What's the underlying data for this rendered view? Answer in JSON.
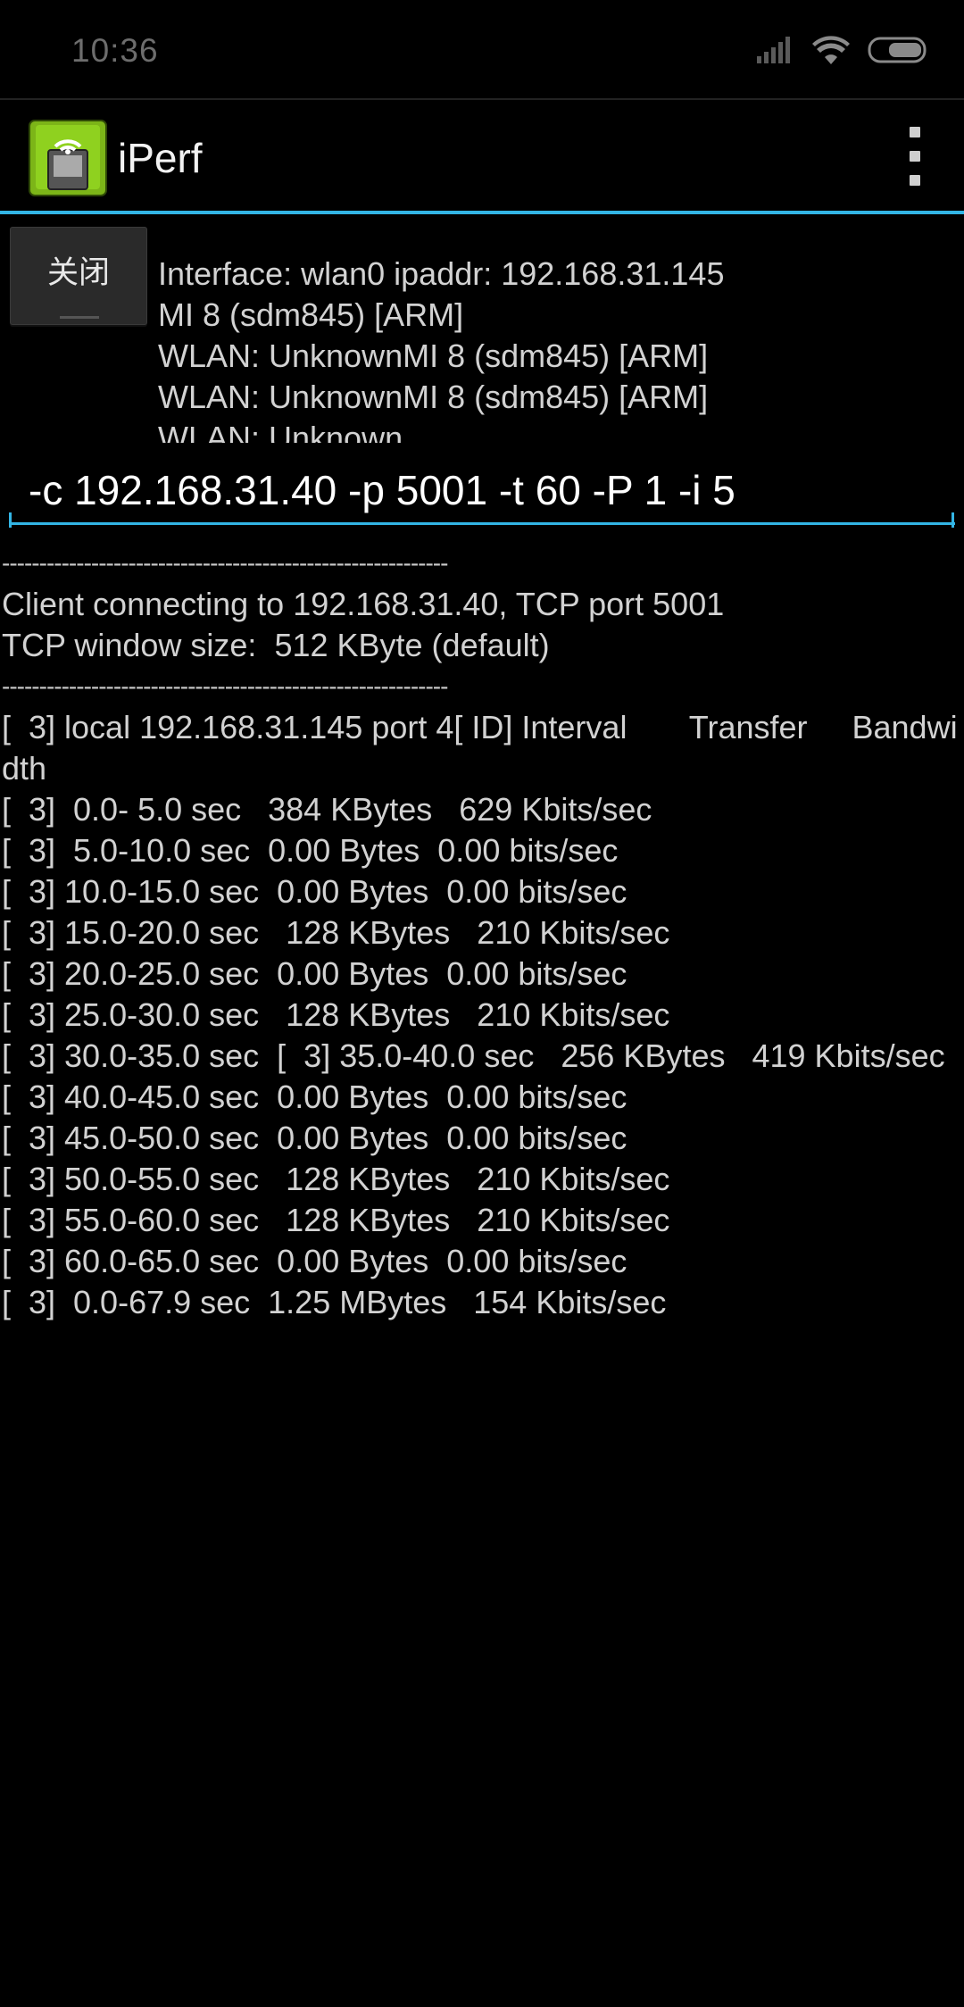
{
  "status_bar": {
    "time": "10:36",
    "icons": [
      "signal-icon",
      "wifi-icon",
      "battery-icon"
    ]
  },
  "action_bar": {
    "title": "iPerf",
    "icon": "app-icon",
    "menu_icon": "overflow-menu-icon"
  },
  "colors": {
    "accent": "#33b5e5",
    "background": "#000000",
    "text": "#d2d2d2"
  },
  "close_button": {
    "label": "关闭"
  },
  "info": {
    "lines": [
      "Interface: wlan0 ipaddr: 192.168.31.145",
      "MI 8 (sdm845) [ARM]",
      "WLAN: UnknownMI 8 (sdm845) [ARM]",
      "WLAN: UnknownMI 8 (sdm845) [ARM]",
      "WLAN: Unknown"
    ]
  },
  "command": {
    "value": "-c 192.168.31.40 -p 5001 -t 60 -P 1 -i 5"
  },
  "output": {
    "separator": "------------------------------------------------------------",
    "connect_line": "Client connecting to 192.168.31.40, TCP port 5001",
    "window_line": "TCP window size:  512 KByte (default)",
    "header_line": "[  3] local 192.168.31.145 port 4[ ID] Interval       Transfer     Bandwidth",
    "rows": [
      "[  3]  0.0- 5.0 sec   384 KBytes   629 Kbits/sec",
      "[  3]  5.0-10.0 sec  0.00 Bytes  0.00 bits/sec",
      "[  3] 10.0-15.0 sec  0.00 Bytes  0.00 bits/sec",
      "[  3] 15.0-20.0 sec   128 KBytes   210 Kbits/sec",
      "[  3] 20.0-25.0 sec  0.00 Bytes  0.00 bits/sec",
      "[  3] 25.0-30.0 sec   128 KBytes   210 Kbits/sec",
      "[  3] 30.0-35.0 sec  [  3] 35.0-40.0 sec   256 KBytes   419 Kbits/sec",
      "[  3] 40.0-45.0 sec  0.00 Bytes  0.00 bits/sec",
      "[  3] 45.0-50.0 sec  0.00 Bytes  0.00 bits/sec",
      "[  3] 50.0-55.0 sec   128 KBytes   210 Kbits/sec",
      "[  3] 55.0-60.0 sec   128 KBytes   210 Kbits/sec",
      "[  3] 60.0-65.0 sec  0.00 Bytes  0.00 bits/sec",
      "[  3]  0.0-67.9 sec  1.25 MBytes   154 Kbits/sec"
    ]
  }
}
